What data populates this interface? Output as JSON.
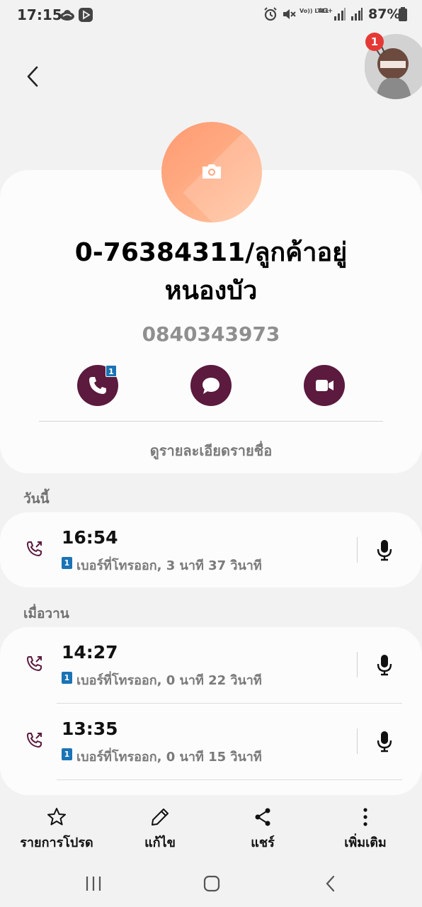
{
  "status_bar": {
    "time": "17:15",
    "battery": "87%",
    "signal_labels": [
      "Vo)) LTE1",
      "4G+"
    ]
  },
  "header": {
    "back_icon": "chevron-left-icon",
    "bubble_badge_count": "1"
  },
  "contact": {
    "name": "0-76384311/ลูกค้าอยู่หนองบัว",
    "number": "0840343973",
    "avatar_color": "#ffa47c",
    "actions": [
      {
        "name": "call",
        "icon": "phone-icon",
        "sim_badge": "1"
      },
      {
        "name": "message",
        "icon": "message-icon"
      },
      {
        "name": "video-call",
        "icon": "video-icon"
      }
    ],
    "view_details_label": "ดูรายละเอียดรายชื่อ"
  },
  "accent_color": "#5b1a3e",
  "sim_badge_color": "#1a73b5",
  "call_log": [
    {
      "title": "วันนี้",
      "entries": [
        {
          "time": "16:54",
          "sim": "1",
          "description": "เบอร์ที่โทรออก, 3 นาที 37 วินาที"
        }
      ]
    },
    {
      "title": "เมื่อวาน",
      "entries": [
        {
          "time": "14:27",
          "sim": "1",
          "description": "เบอร์ที่โทรออก, 0 นาที 22 วินาที"
        },
        {
          "time": "13:35",
          "sim": "1",
          "description": "เบอร์ที่โทรออก, 0 นาที 15 วินาที"
        }
      ]
    }
  ],
  "toolbar": {
    "favorite_label": "รายการโปรด",
    "edit_label": "แก้ไข",
    "share_label": "แชร์",
    "more_label": "เพิ่มเติม"
  }
}
